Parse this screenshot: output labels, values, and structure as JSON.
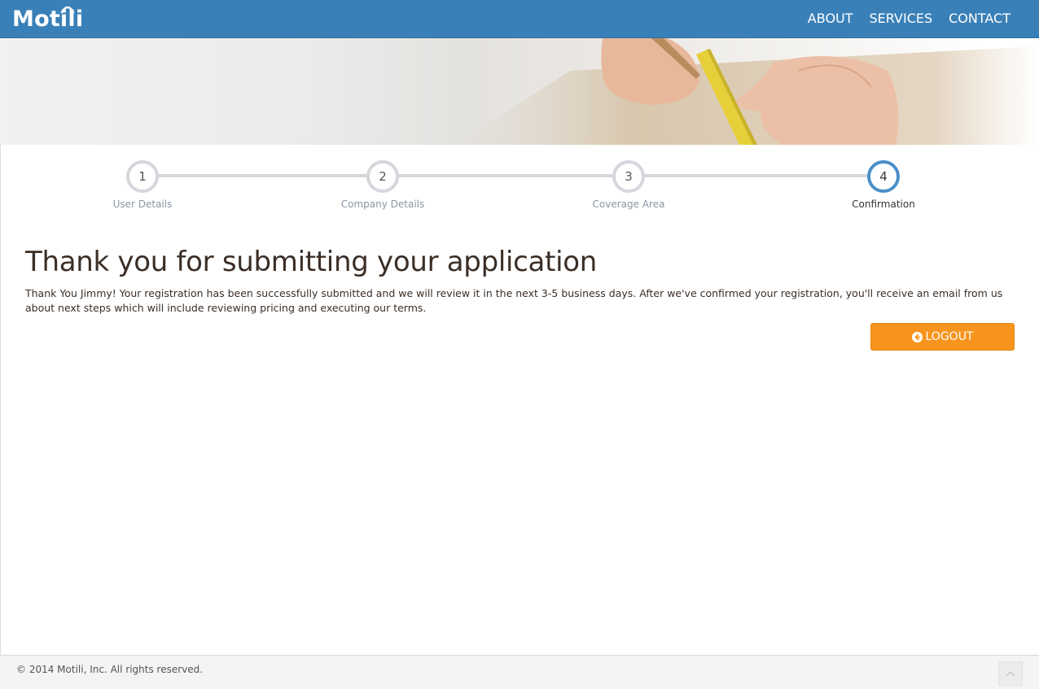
{
  "header": {
    "logo_text": "Motili",
    "nav": [
      {
        "label": "ABOUT"
      },
      {
        "label": "SERVICES"
      },
      {
        "label": "CONTACT"
      }
    ]
  },
  "stepper": {
    "steps": [
      {
        "number": "1",
        "label": "User Details"
      },
      {
        "number": "2",
        "label": "Company Details"
      },
      {
        "number": "3",
        "label": "Coverage Area"
      },
      {
        "number": "4",
        "label": "Confirmation"
      }
    ],
    "current_step": 4
  },
  "main": {
    "title": "Thank you for submitting your application",
    "message": "Thank You Jimmy! Your registration has been successfully submitted and we will review it in the next 3-5 business days. After we've confirmed your registration, you'll receive an email from us about next steps which will include reviewing pricing and executing our terms.",
    "logout_label": "LOGOUT"
  },
  "footer": {
    "copyright": "© 2014 Motili, Inc. All rights reserved."
  },
  "colors": {
    "header_bg": "#3a80b8",
    "active_step": "#4b8fc8",
    "inactive_step": "#d4d7dc",
    "button_orange": "#f7941d",
    "title_text": "#3b2e26"
  },
  "icons": {
    "logo_arc": "signal-arc-icon",
    "logout": "arrow-circle-left-icon",
    "scroll_top": "chevron-up-icon"
  }
}
